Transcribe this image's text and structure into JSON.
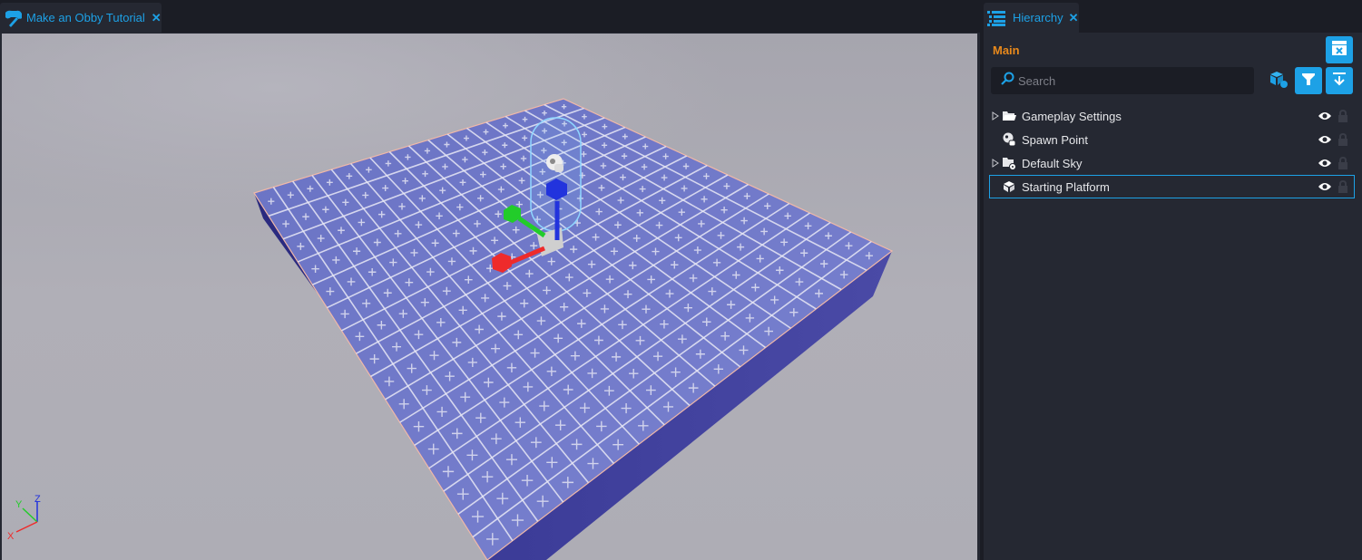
{
  "viewport_panel": {
    "tab_label": "Make an Obby Tutorial",
    "tab_icon": "game-controller-hammer-icon",
    "close_icon": "close-icon",
    "axis_gizmo": {
      "x_label": "X",
      "y_label": "Y",
      "z_label": "Z"
    }
  },
  "hierarchy_panel": {
    "tab_label": "Hierarchy",
    "tab_icon": "list-icon",
    "close_icon": "close-icon",
    "scene_label": "Main",
    "search": {
      "placeholder": "Search",
      "value": ""
    },
    "buttons": {
      "scene_settings": "clapperboard-icon",
      "create_object": "add-object-icon",
      "filter": "filter-icon",
      "collapse_all": "collapse-arrow-icon"
    },
    "items": [
      {
        "label": "Gameplay Settings",
        "icon": "folder-icon",
        "expandable": true,
        "selected": false,
        "visible": true,
        "locked": false
      },
      {
        "label": "Spawn Point",
        "icon": "spawn-point-icon",
        "expandable": false,
        "selected": false,
        "visible": true,
        "locked": false
      },
      {
        "label": "Default Sky",
        "icon": "folder-settings-icon",
        "expandable": true,
        "selected": false,
        "visible": true,
        "locked": false
      },
      {
        "label": "Starting Platform",
        "icon": "cube-icon",
        "expandable": false,
        "selected": true,
        "visible": true,
        "locked": false
      }
    ]
  },
  "colors": {
    "accent": "#1da1e6",
    "scene_label": "#e8891c",
    "panel_bg": "#252832",
    "chrome_bg": "#1b1d25",
    "platform_top": "#6f78c8",
    "platform_side": "#2f2f8a",
    "gizmo_x": "#ee2b2b",
    "gizmo_y": "#22cc2a",
    "gizmo_z": "#2233dd"
  }
}
